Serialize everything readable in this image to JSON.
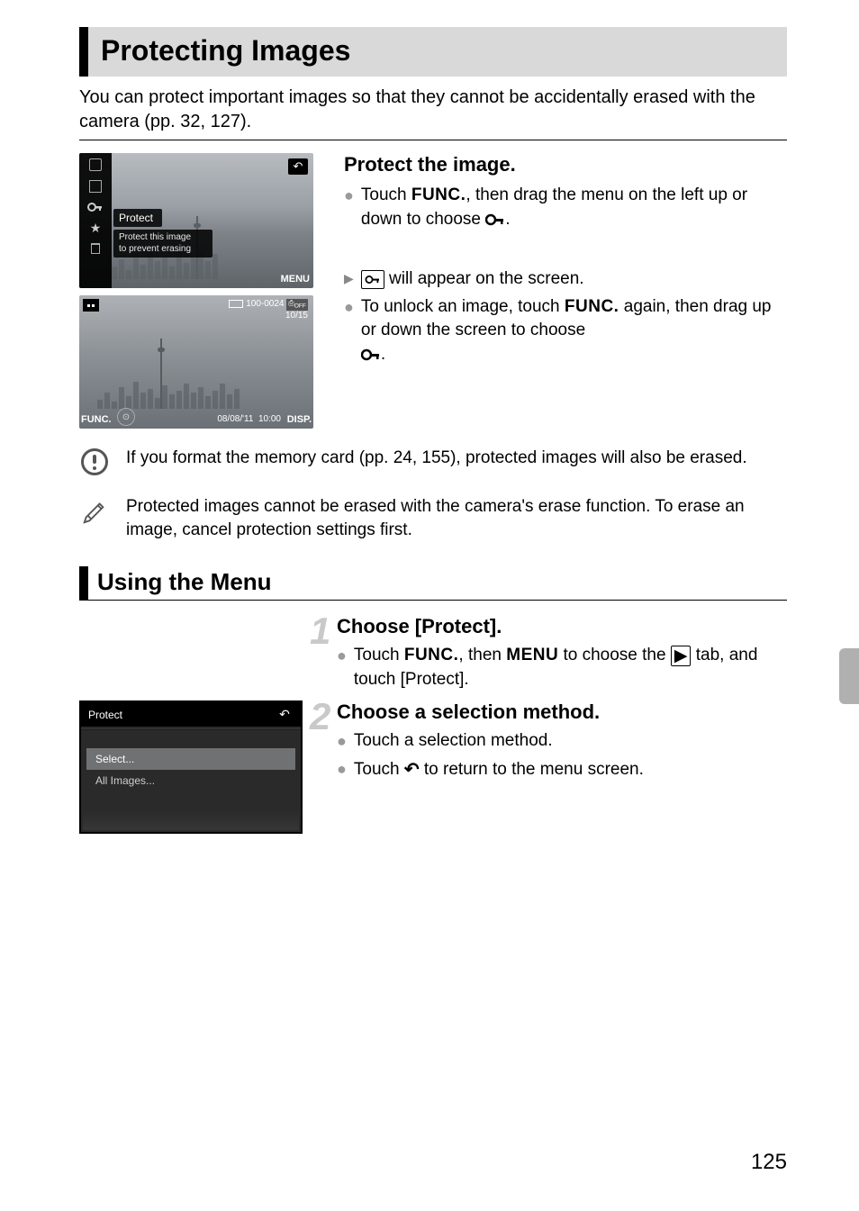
{
  "title": "Protecting Images",
  "intro": "You can protect important images so that they cannot be accidentally erased with the camera (pp. 32, 127).",
  "screenshot1": {
    "protect_label": "Protect",
    "protect_sub1": "Protect this image",
    "protect_sub2": "to prevent erasing",
    "menu_button": "MENU"
  },
  "screenshot2": {
    "folder_file": "100-0024",
    "index": "10/15",
    "loff": "OFF",
    "date": "08/08/'11",
    "time": "10:00",
    "func": "FUNC.",
    "disp": "DISP."
  },
  "section1": {
    "heading": "Protect the image.",
    "p1a": "Touch ",
    "p1_func": "FUNC.",
    "p1b": ", then drag the menu on the left up or down to choose ",
    "p1c": ".",
    "p2a": " will appear on the screen.",
    "p3a": "To unlock an image, touch ",
    "p3_func": "FUNC.",
    "p3b": " again, then drag up or down the screen to choose ",
    "p3c": "."
  },
  "warning": "If you format the memory card (pp. 24, 155), protected images will also be erased.",
  "note": "Protected images cannot be erased with the camera's erase function. To erase an image, cancel protection settings first.",
  "section2_heading": "Using the Menu",
  "step1": {
    "num": "1",
    "heading": "Choose [Protect].",
    "p1a": "Touch ",
    "p1_func": "FUNC.",
    "p1b": ", then ",
    "p1_menu": "MENU",
    "p1c": " to choose the ",
    "p1d": " tab, and touch [Protect]."
  },
  "step2": {
    "num": "2",
    "heading": "Choose a selection method.",
    "p1": "Touch a selection method.",
    "p2a": "Touch ",
    "p2b": " to return to the menu screen."
  },
  "screenshot3": {
    "title": "Protect",
    "opt_select": "Select...",
    "opt_all": "All Images..."
  },
  "page_number": "125"
}
